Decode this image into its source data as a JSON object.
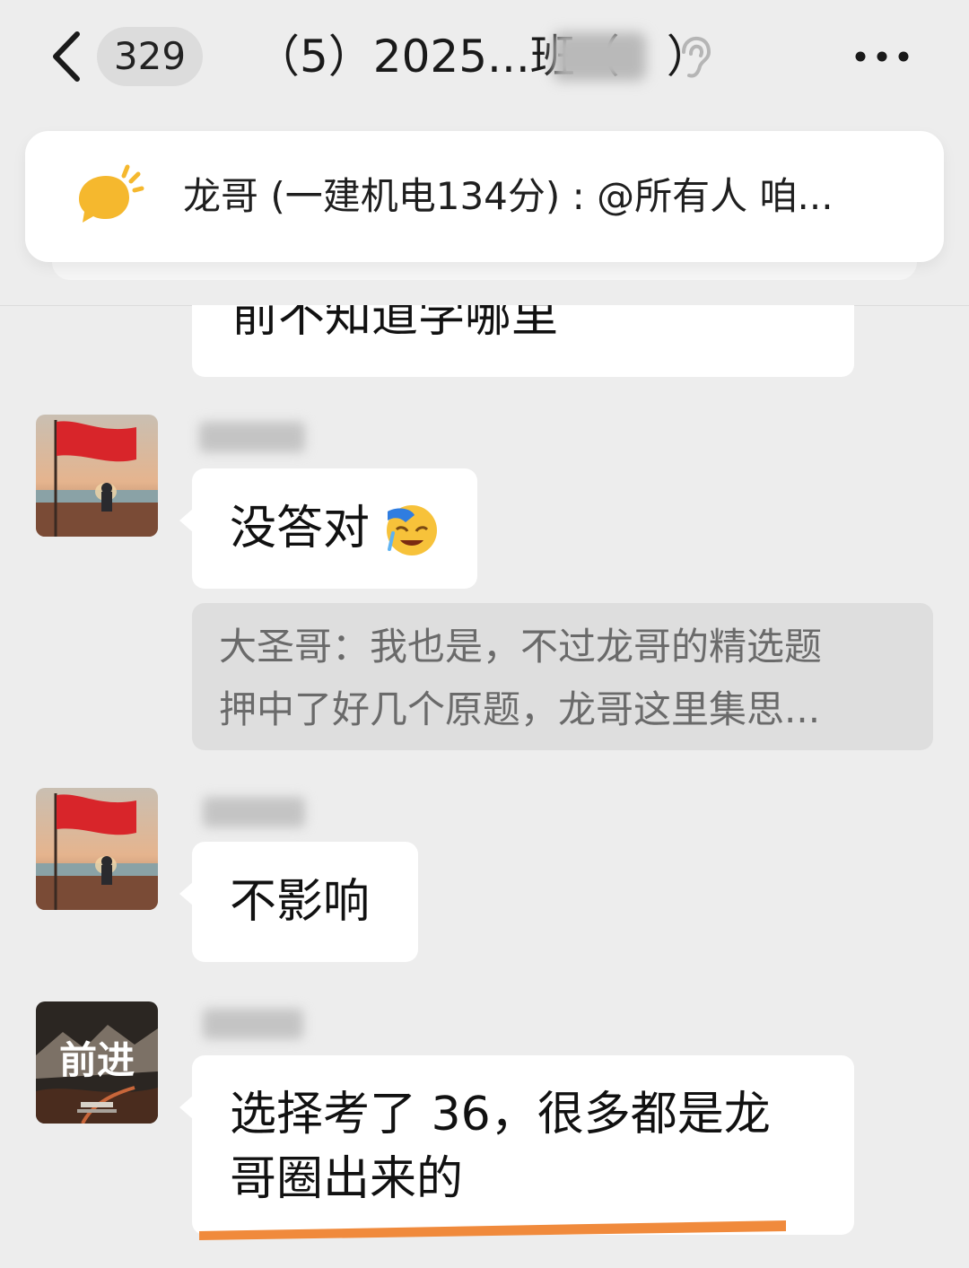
{
  "header": {
    "unread_count": "329",
    "title": "（5）2025...班（",
    "title_tail": "）"
  },
  "pinned": {
    "text": "龙哥 (一建机电134分) : @所有人 咱..."
  },
  "messages": [
    {
      "type": "cut_text",
      "text": "前不知道学哪里"
    },
    {
      "type": "text",
      "text": "没答对"
    },
    {
      "type": "quote",
      "line1": "大圣哥：我也是，不过龙哥的精选题",
      "line2": "押中了好几个原题，龙哥这里集思..."
    },
    {
      "type": "text",
      "text": "不影响"
    },
    {
      "type": "text",
      "line1": "选择考了 36，很多都是龙",
      "line2": "哥圈出来的"
    }
  ],
  "avatar_art": {
    "forward_text": "前进"
  },
  "colors": {
    "accent_orange": "#f08a3c",
    "pin_yellow": "#f5b82e",
    "flag_red": "#d8252a"
  }
}
